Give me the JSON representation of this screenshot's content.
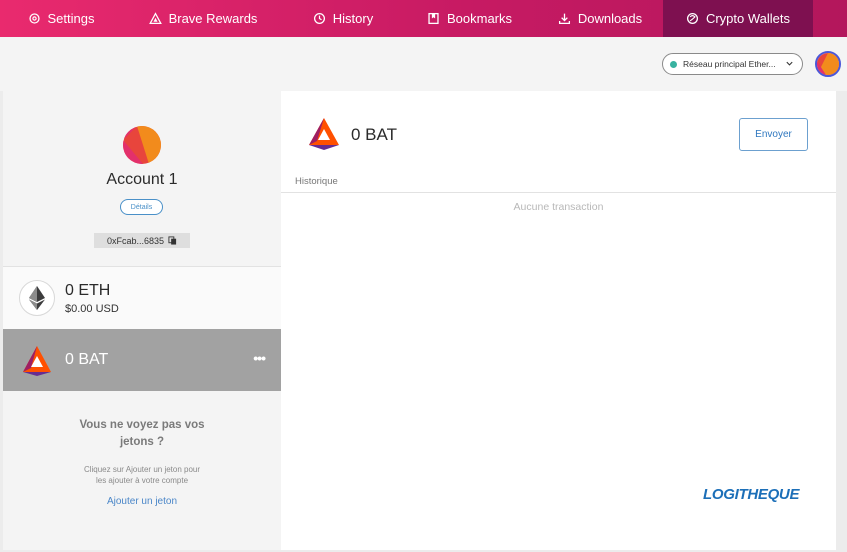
{
  "nav": {
    "tabs": [
      {
        "label": "Settings",
        "icon": "gear-icon"
      },
      {
        "label": "Brave Rewards",
        "icon": "triangle-icon"
      },
      {
        "label": "History",
        "icon": "clock-icon"
      },
      {
        "label": "Bookmarks",
        "icon": "bookmark-icon"
      },
      {
        "label": "Downloads",
        "icon": "download-icon"
      },
      {
        "label": "Crypto Wallets",
        "icon": "wallet-icon",
        "active": true
      }
    ]
  },
  "header": {
    "network": "Réseau principal Ether..."
  },
  "account": {
    "name": "Account 1",
    "details_label": "Détails",
    "address": "0xFcab...6835"
  },
  "assets": [
    {
      "symbol": "ETH",
      "balance": "0 ETH",
      "usd": "$0.00 USD",
      "icon": "ethereum-icon"
    },
    {
      "symbol": "BAT",
      "balance": "0 BAT",
      "icon": "bat-icon",
      "selected": true,
      "more": "•••"
    }
  ],
  "empty_tokens": {
    "title": "Vous ne voyez pas vos jetons ?",
    "description_line1": "Cliquez sur Ajouter un jeton pour",
    "description_line2": "les ajouter à votre compte",
    "add_link": "Ajouter un jeton"
  },
  "detail": {
    "title": "0 BAT",
    "send_label": "Envoyer",
    "history_label": "Historique",
    "empty_history": "Aucune transaction"
  },
  "watermark": "LOGITHEQUE",
  "colors": {
    "nav_gradient_start": "#e92a6e",
    "nav_gradient_end": "#b3175c",
    "nav_active": "#7e1050",
    "accent_blue": "#2f77bf",
    "selected_row": "#a2a2a2"
  }
}
